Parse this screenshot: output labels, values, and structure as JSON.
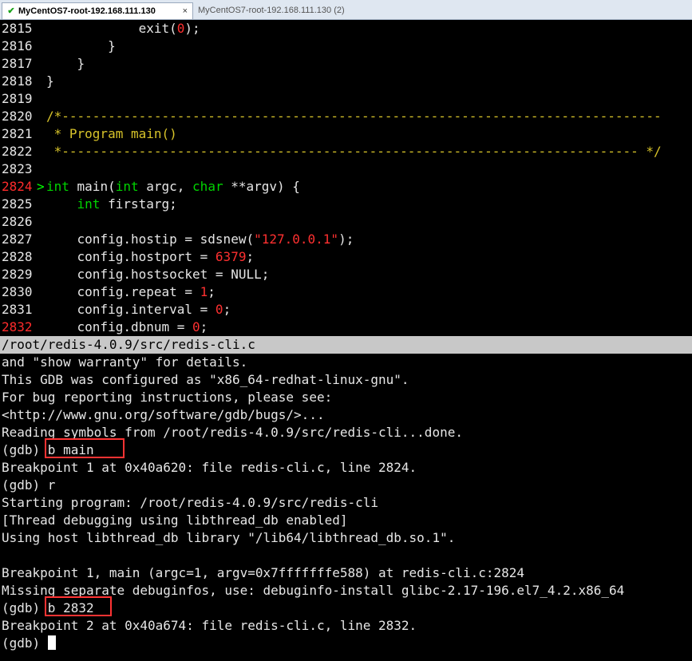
{
  "tabs": [
    {
      "label": "MyCentOS7-root-192.168.111.130",
      "active": true,
      "icon": "check-icon"
    },
    {
      "label": "MyCentOS7-root-192.168.111.130 (2)",
      "active": false,
      "icon": "terminal-icon"
    }
  ],
  "close_glyph": "×",
  "source_view": {
    "lines": [
      {
        "n": "2815",
        "text": "            exit(0);"
      },
      {
        "n": "2816",
        "text": "        }"
      },
      {
        "n": "2817",
        "text": "    }"
      },
      {
        "n": "2818",
        "text": "}"
      },
      {
        "n": "2819",
        "text": ""
      },
      {
        "n": "2820",
        "text": "/*------------------------------------------------------------------------------"
      },
      {
        "n": "2821",
        "text": " * Program main()"
      },
      {
        "n": "2822",
        "text": " *--------------------------------------------------------------------------- */"
      },
      {
        "n": "2823",
        "text": ""
      },
      {
        "n": "2824",
        "text": "int main(int argc, char **argv) {"
      },
      {
        "n": "2825",
        "text": "    int firstarg;"
      },
      {
        "n": "2826",
        "text": ""
      },
      {
        "n": "2827",
        "text": "    config.hostip = sdsnew(\"127.0.0.1\");"
      },
      {
        "n": "2828",
        "text": "    config.hostport = 6379;"
      },
      {
        "n": "2829",
        "text": "    config.hostsocket = NULL;"
      },
      {
        "n": "2830",
        "text": "    config.repeat = 1;"
      },
      {
        "n": "2831",
        "text": "    config.interval = 0;"
      },
      {
        "n": "2832",
        "text": "    config.dbnum = 0;"
      }
    ],
    "current_line": "2824",
    "breakpoint_line": "2832",
    "arrow_glyph": ">"
  },
  "status_bar": "/root/redis-4.0.9/src/redis-cli.c",
  "console": [
    "and \"show warranty\" for details.",
    "This GDB was configured as \"x86_64-redhat-linux-gnu\".",
    "For bug reporting instructions, please see:",
    "<http://www.gnu.org/software/gdb/bugs/>...",
    "Reading symbols from /root/redis-4.0.9/src/redis-cli...done.",
    "(gdb) b main",
    "Breakpoint 1 at 0x40a620: file redis-cli.c, line 2824.",
    "(gdb) r",
    "Starting program: /root/redis-4.0.9/src/redis-cli",
    "[Thread debugging using libthread_db enabled]",
    "Using host libthread_db library \"/lib64/libthread_db.so.1\".",
    "",
    "Breakpoint 1, main (argc=1, argv=0x7fffffffe588) at redis-cli.c:2824",
    "Missing separate debuginfos, use: debuginfo-install glibc-2.17-196.el7_4.2.x86_64",
    "(gdb) b 2832",
    "Breakpoint 2 at 0x40a674: file redis-cli.c, line 2832.",
    "(gdb) "
  ],
  "colors": {
    "keyword": "#00d400",
    "literal": "#ff3030",
    "comment": "#d7c32a",
    "highlight_box": "#ff3333",
    "status_bar_bg": "#c8c8c8"
  }
}
